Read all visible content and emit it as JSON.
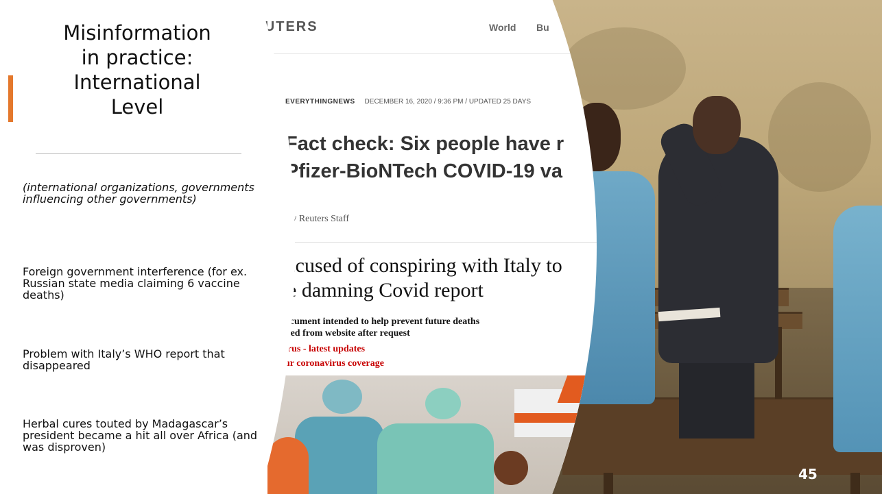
{
  "slide": {
    "title_lines": [
      "Misinformation",
      "in practice:",
      "International",
      "Level"
    ],
    "intro": "(international organizations, governments influencing other governments)",
    "points": [
      "Foreign government interference (for ex. Russian state media claiming 6 vaccine deaths)",
      "Problem with Italy’s WHO report that disappeared",
      "Herbal cures touted by Madagascar’s president became a hit all over Africa (and was disproven)"
    ],
    "page_number": "45",
    "accent_color": "#e4782c"
  },
  "reuters_clip": {
    "logo": "REUTERS",
    "nav": [
      "World",
      "Bu"
    ],
    "tag": "EVERYTHINGNEWS",
    "dateline": "DECEMBER 16, 2020 / 9:36 PM / UPDATED 25 DAYS",
    "headline_lines": [
      "Fact check: Six people have r",
      "Pfizer-BioNTech COVID-19 va"
    ],
    "byline": "By Reuters Staff"
  },
  "guardian_clip": {
    "headline_lines": [
      "accused of conspiring with Italy to",
      "ve damning Covid report"
    ],
    "standfirst_lines": [
      "document intended to help prevent future deaths",
      "ulled from website after request"
    ],
    "links": [
      "virus - latest updates",
      "our coronavirus coverage"
    ],
    "link_color": "#c70000"
  },
  "photo": {
    "description_icon": "classroom-photo"
  }
}
